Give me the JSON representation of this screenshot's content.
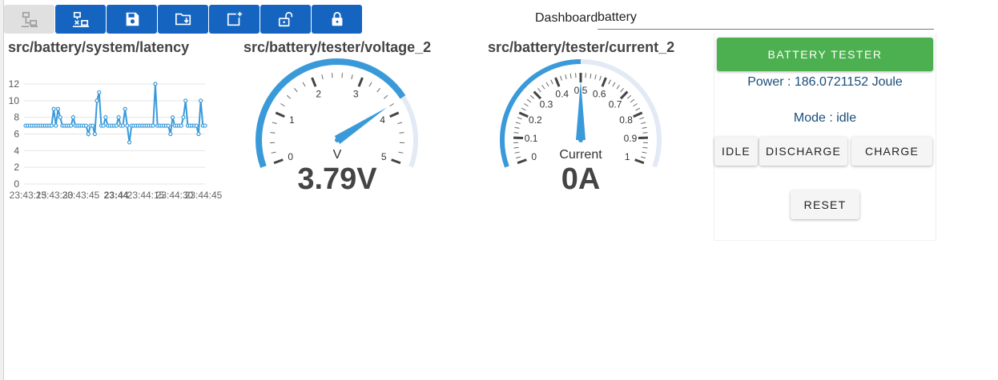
{
  "toolbar": {
    "buttons": [
      {
        "icon": "network-disconnected-icon",
        "enabled": false
      },
      {
        "icon": "network-disconnect-icon",
        "enabled": true
      },
      {
        "icon": "save-icon",
        "enabled": true
      },
      {
        "icon": "folder-download-icon",
        "enabled": true
      },
      {
        "icon": "add-widget-icon",
        "enabled": true
      },
      {
        "icon": "lock-open-icon",
        "enabled": true
      },
      {
        "icon": "lock-icon",
        "enabled": true
      }
    ]
  },
  "header": {
    "dashboard_label": "Dashboard",
    "search_value": "battery"
  },
  "latency_widget": {
    "title": "src/battery/system/latency",
    "chart_data": {
      "type": "line",
      "title": "src/battery/system/latency",
      "ylim": [
        0,
        12
      ],
      "yticks": [
        "0",
        "2",
        "4",
        "6",
        "8",
        "10",
        "12"
      ],
      "xticks": [
        "23:43:15",
        "23:43:30",
        "23:43:45",
        "23:44",
        "23:44:15",
        "23:44:30",
        "23:44:45"
      ],
      "grid": true,
      "values": [
        7,
        7,
        7,
        7,
        7,
        7,
        7,
        7,
        7,
        7,
        7,
        7,
        7,
        9,
        7,
        9,
        8,
        7,
        7,
        7,
        7,
        7,
        8,
        7,
        7,
        7,
        7,
        7,
        7,
        6,
        7,
        7,
        6,
        10,
        11,
        7,
        7,
        8,
        7,
        7,
        7,
        7,
        7,
        8,
        7,
        7,
        9,
        7,
        5,
        7,
        7,
        7,
        7,
        7,
        7,
        7,
        7,
        7,
        7,
        7,
        12,
        7,
        7,
        7,
        7,
        7,
        7,
        6,
        8,
        7,
        7,
        7,
        7,
        8,
        10,
        7,
        7,
        7,
        7,
        7,
        6,
        10,
        7,
        7
      ]
    }
  },
  "voltage_widget": {
    "title": "src/battery/tester/voltage_2",
    "unit_label": "V",
    "value_text": "3.79V",
    "value": 3.79,
    "min": 0,
    "max": 5,
    "tick_labels": [
      "0",
      "1",
      "2",
      "3",
      "4",
      "5"
    ]
  },
  "current_widget": {
    "title": "src/battery/tester/current_2",
    "unit_label": "Current",
    "value_text": "0A",
    "value": 0.5,
    "min": 0,
    "max": 1,
    "tick_labels": [
      "0",
      "0.1",
      "0.2",
      "0.3",
      "0.4",
      "0.5",
      "0.6",
      "0.7",
      "0.8",
      "0.9",
      "1"
    ]
  },
  "battery_panel": {
    "title_button": "BATTERY TESTER",
    "power_text": "Power : 186.0721152 Joule",
    "mode_text": "Mode : idle",
    "idle_label": "IDLE",
    "discharge_label": "DISCHARGE",
    "charge_label": "CHARGE",
    "reset_label": "RESET"
  },
  "colors": {
    "toolbar_button": "#1565c0",
    "gauge_accent": "#3a9ad9",
    "gauge_track": "#e3eaf5",
    "battery_button": "#4caf50",
    "power_text": "#1a4f7a"
  }
}
